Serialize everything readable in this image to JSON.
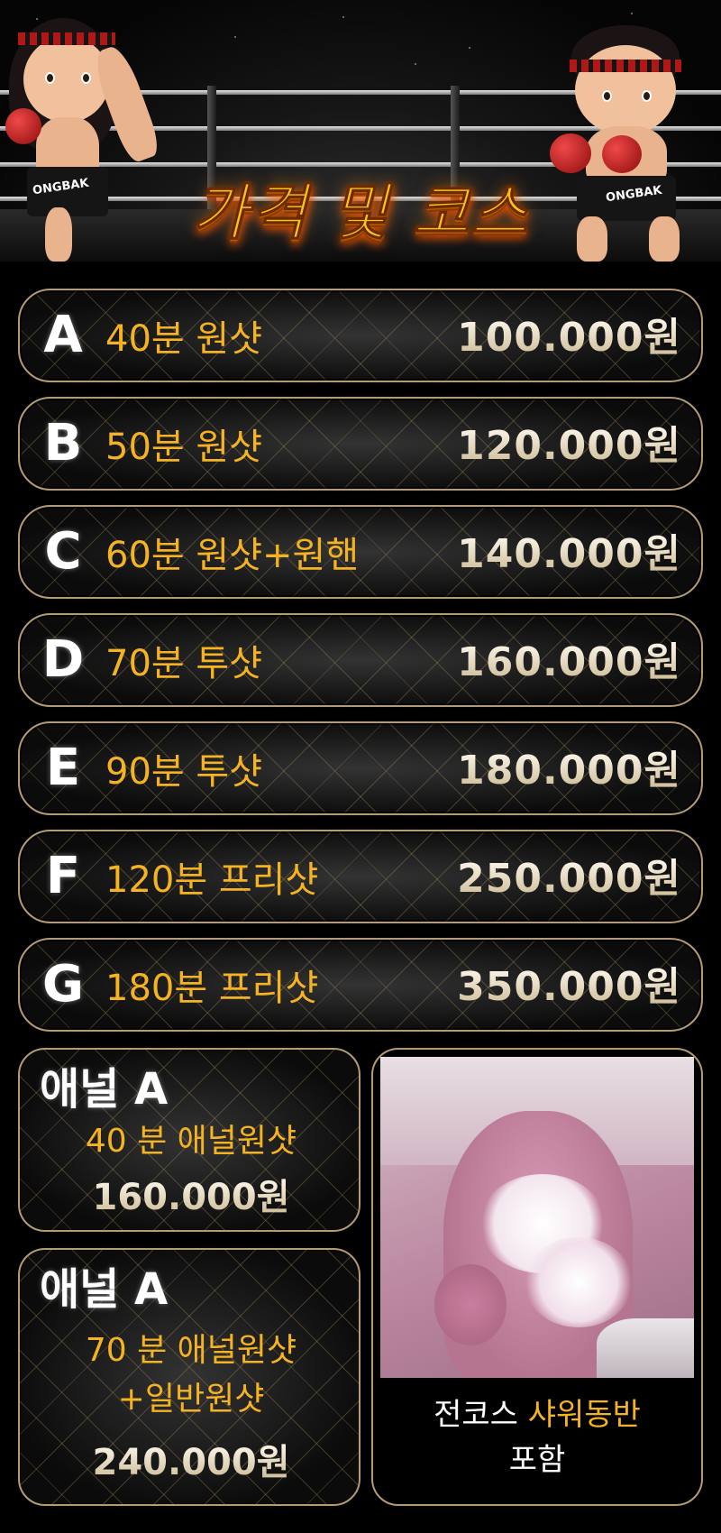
{
  "header": {
    "title": "가격 및 코스",
    "fighter_left_logo": "ONGBAK",
    "fighter_right_logo": "ONGBAK"
  },
  "courses": [
    {
      "letter": "A",
      "name": "40분 원샷",
      "price": "100.000원"
    },
    {
      "letter": "B",
      "name": "50분 원샷",
      "price": "120.000원"
    },
    {
      "letter": "C",
      "name": "60분 원샷+원핸",
      "price": "140.000원"
    },
    {
      "letter": "D",
      "name": "70분 투샷",
      "price": "160.000원"
    },
    {
      "letter": "E",
      "name": "90분 투샷",
      "price": "180.000원"
    },
    {
      "letter": "F",
      "name": "120분 프리샷",
      "price": "250.000원"
    },
    {
      "letter": "G",
      "name": "180분 프리샷",
      "price": "350.000원"
    }
  ],
  "anal_courses": [
    {
      "title": "애널 A",
      "lines": [
        "40 분 애널원샷"
      ],
      "price": "160.000원"
    },
    {
      "title": "애널 A",
      "lines": [
        "70 분 애널원샷",
        "+일반원샷"
      ],
      "price": "240.000원"
    }
  ],
  "promo": {
    "caption_prefix": "전코스 ",
    "caption_highlight": "샤워동반",
    "caption_suffix": "포함"
  },
  "colors": {
    "accent_gold": "#f5b322",
    "border_gold": "#b39b74",
    "background": "#000000"
  }
}
